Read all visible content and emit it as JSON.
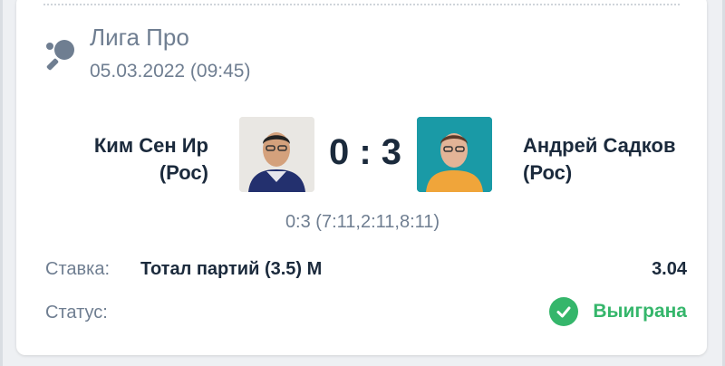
{
  "match": {
    "league": "Лига Про",
    "datetime": "05.03.2022 (09:45)",
    "player_left_line1": "Ким Сен Ир",
    "player_left_line2": "(Рос)",
    "player_right_line1": "Андрей Садков",
    "player_right_line2": "(Рос)",
    "score": "0 : 3",
    "sets": "0:3 (7:11,2:11,8:11)"
  },
  "bet": {
    "label": "Ставка:",
    "value": "Тотал партий (3.5) М",
    "odds": "3.04"
  },
  "status": {
    "label": "Статус:",
    "value": "Выиграна",
    "color": "#35b66b",
    "icon": "check-circle-icon"
  },
  "colors": {
    "primary_text": "#1b2a3c",
    "secondary_text": "#6f7e91",
    "success": "#35b66b"
  }
}
